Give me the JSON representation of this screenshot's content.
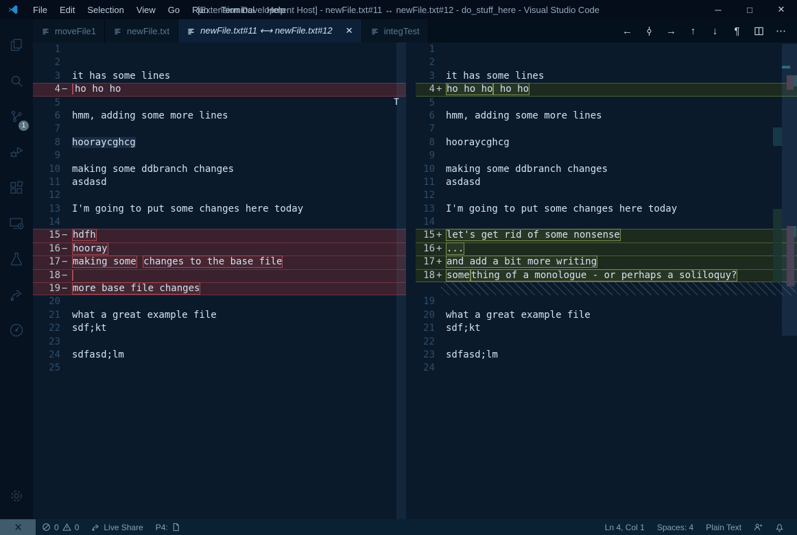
{
  "window": {
    "title": "[Extension Development Host] - newFile.txt#11 ↔ newFile.txt#12 - do_stuff_here - Visual Studio Code",
    "menus": [
      "File",
      "Edit",
      "Selection",
      "View",
      "Go",
      "Run",
      "Terminal",
      "Help"
    ],
    "controls": [
      {
        "name": "minimize-button",
        "glyph": "─"
      },
      {
        "name": "maximize-button",
        "glyph": "□"
      },
      {
        "name": "close-button",
        "glyph": "✕"
      }
    ]
  },
  "colors": {
    "titlebar_bg": "#040d19",
    "tabbar_bg": "#05101d",
    "tab_inactive_bg": "#081624",
    "tab_active_bg": "#0c2137",
    "editor_bg": "#0a1a2b",
    "activitybar_bg": "#071221",
    "statusbar_bg": "#0a2033",
    "remote_segment_bg": "#3f5b6c",
    "text": "#d2e3f2",
    "line_number": "#2f4c68",
    "diff_line_number": "#bcc8d2",
    "removed_line_bg": "#3a212d",
    "removed_border": "#6e333f",
    "removed_char_box": "#a34b55",
    "added_line_bg": "#1d2a1e",
    "added_border": "#4d6034",
    "added_char_box": "#7d9156",
    "logo_blue": "#2489cf",
    "scm_badge_bg": "#5b7383",
    "word_highlight": "#1b2d44"
  },
  "tabs": [
    {
      "label": "moveFile1",
      "active": false
    },
    {
      "label": "newFile.txt",
      "active": false
    },
    {
      "label": "newFile.txt#11 ⟷ newFile.txt#12",
      "active": true,
      "italic": true,
      "close_glyph": "✕"
    },
    {
      "label": "integTest",
      "active": false
    }
  ],
  "editor_actions": [
    {
      "name": "nav-back-icon",
      "glyph": "←"
    },
    {
      "name": "swap-diff-icon",
      "glyph": "svg:swap"
    },
    {
      "name": "nav-forward-icon",
      "glyph": "→"
    },
    {
      "name": "previous-change-icon",
      "glyph": "↑"
    },
    {
      "name": "next-change-icon",
      "glyph": "↓"
    },
    {
      "name": "toggle-whitespace-icon",
      "glyph": "¶"
    },
    {
      "name": "split-editor-icon",
      "glyph": "svg:split"
    },
    {
      "name": "more-actions-icon",
      "glyph": "⋯"
    }
  ],
  "activity_bar": {
    "items": [
      {
        "name": "explorer-icon"
      },
      {
        "name": "search-icon"
      },
      {
        "name": "source-control-icon",
        "badge": "1"
      },
      {
        "name": "run-debug-icon"
      },
      {
        "name": "extensions-icon"
      },
      {
        "name": "remote-explorer-icon"
      },
      {
        "name": "test-beaker-icon"
      },
      {
        "name": "live-share-icon"
      },
      {
        "name": "performance-icon"
      }
    ],
    "bottom_items": [
      {
        "name": "settings-gear-icon"
      }
    ]
  },
  "left_editor": {
    "cursor_marker": "T",
    "lines": [
      {
        "n": "1",
        "t": ""
      },
      {
        "n": "2",
        "t": ""
      },
      {
        "n": "3",
        "t": "it has some lines"
      },
      {
        "n": "4",
        "sign": "−",
        "type": "removed",
        "edge": "both",
        "segs": [
          {
            "m": true
          },
          {
            "t": "ho ho ho"
          }
        ]
      },
      {
        "n": "5",
        "t": ""
      },
      {
        "n": "6",
        "t": "hmm, adding some more lines"
      },
      {
        "n": "7",
        "t": ""
      },
      {
        "n": "8",
        "segs": [
          {
            "t": "hooraycghcg",
            "hl": true
          }
        ]
      },
      {
        "n": "9",
        "t": ""
      },
      {
        "n": "10",
        "t": "making some ddbranch changes"
      },
      {
        "n": "11",
        "t": "asdasd"
      },
      {
        "n": "12",
        "t": ""
      },
      {
        "n": "13",
        "t": "I'm going to put some changes here today"
      },
      {
        "n": "14",
        "t": ""
      },
      {
        "n": "15",
        "sign": "−",
        "type": "removed",
        "edge": "top",
        "segs": [
          {
            "t": "hdfh",
            "box": true
          }
        ]
      },
      {
        "n": "16",
        "sign": "−",
        "type": "removed",
        "edge": "top",
        "segs": [
          {
            "t": "hooray",
            "box": true
          }
        ]
      },
      {
        "n": "17",
        "sign": "−",
        "type": "removed",
        "edge": "top",
        "segs": [
          {
            "t": "making some",
            "box": true
          },
          {
            "t": " "
          },
          {
            "t": "changes to the base file",
            "box": true
          }
        ]
      },
      {
        "n": "18",
        "sign": "−",
        "type": "removed",
        "edge": "top",
        "segs": [
          {
            "m": true
          }
        ]
      },
      {
        "n": "19",
        "sign": "−",
        "type": "removed",
        "edge": "both",
        "segs": [
          {
            "t": "more base file changes",
            "box": true
          }
        ]
      },
      {
        "n": "20",
        "t": ""
      },
      {
        "n": "21",
        "t": "what a great example file"
      },
      {
        "n": "22",
        "t": "sdf;kt"
      },
      {
        "n": "23",
        "t": ""
      },
      {
        "n": "24",
        "t": "sdfasd;lm"
      },
      {
        "n": "25",
        "t": ""
      }
    ]
  },
  "right_editor": {
    "lines": [
      {
        "n": "1",
        "t": ""
      },
      {
        "n": "2",
        "t": ""
      },
      {
        "n": "3",
        "t": "it has some lines"
      },
      {
        "n": "4",
        "sign": "+",
        "type": "added",
        "edge": "both",
        "segs": [
          {
            "t": "ho ho ho",
            "box": true
          },
          {
            "t": " ho ho",
            "box": true
          }
        ]
      },
      {
        "n": "5",
        "t": ""
      },
      {
        "n": "6",
        "t": "hmm, adding some more lines"
      },
      {
        "n": "7",
        "t": ""
      },
      {
        "n": "8",
        "t": "hooraycghcg"
      },
      {
        "n": "9",
        "t": ""
      },
      {
        "n": "10",
        "t": "making some ddbranch changes"
      },
      {
        "n": "11",
        "t": "asdasd"
      },
      {
        "n": "12",
        "t": ""
      },
      {
        "n": "13",
        "t": "I'm going to put some changes here today"
      },
      {
        "n": "14",
        "t": ""
      },
      {
        "n": "15",
        "sign": "+",
        "type": "added",
        "edge": "top",
        "segs": [
          {
            "t": "let's get rid of some nonsense",
            "box": true
          }
        ]
      },
      {
        "n": "16",
        "sign": "+",
        "type": "added",
        "edge": "top",
        "segs": [
          {
            "t": "...",
            "box": true
          }
        ]
      },
      {
        "n": "17",
        "sign": "+",
        "type": "added",
        "edge": "top",
        "segs": [
          {
            "t": "and add a bit more writing",
            "box": true
          }
        ]
      },
      {
        "n": "18",
        "sign": "+",
        "type": "added",
        "edge": "both",
        "segs": [
          {
            "t": "some",
            "box": true
          },
          {
            "t": "thing of a monologue - or perhaps a soliloquy?",
            "box": true
          }
        ]
      },
      {
        "type": "filler"
      },
      {
        "n": "19",
        "t": ""
      },
      {
        "n": "20",
        "t": "what a great example file"
      },
      {
        "n": "21",
        "t": "sdf;kt"
      },
      {
        "n": "22",
        "t": ""
      },
      {
        "n": "23",
        "t": "sdfasd;lm"
      },
      {
        "n": "24",
        "t": ""
      }
    ]
  },
  "status_bar": {
    "remote": {
      "icon": "remote-indicator-icon"
    },
    "left_items": [
      {
        "name": "problems",
        "parts": [
          {
            "icon": "error-icon"
          },
          {
            "text": "0"
          },
          {
            "icon": "warning-icon"
          },
          {
            "text": "0"
          }
        ]
      },
      {
        "name": "live-share",
        "parts": [
          {
            "icon": "live-share-icon"
          },
          {
            "text": "Live Share"
          }
        ]
      },
      {
        "name": "perforce",
        "parts": [
          {
            "text": "P4:"
          },
          {
            "icon": "document-icon"
          }
        ]
      }
    ],
    "right_items": [
      {
        "name": "cursor-position",
        "parts": [
          {
            "text": "Ln 4, Col 1"
          }
        ]
      },
      {
        "name": "indentation",
        "parts": [
          {
            "text": "Spaces: 4"
          }
        ]
      },
      {
        "name": "language-mode",
        "parts": [
          {
            "text": "Plain Text"
          }
        ]
      },
      {
        "name": "feedback",
        "parts": [
          {
            "icon": "feedback-icon"
          }
        ]
      },
      {
        "name": "notifications",
        "parts": [
          {
            "icon": "bell-icon"
          }
        ]
      }
    ]
  }
}
